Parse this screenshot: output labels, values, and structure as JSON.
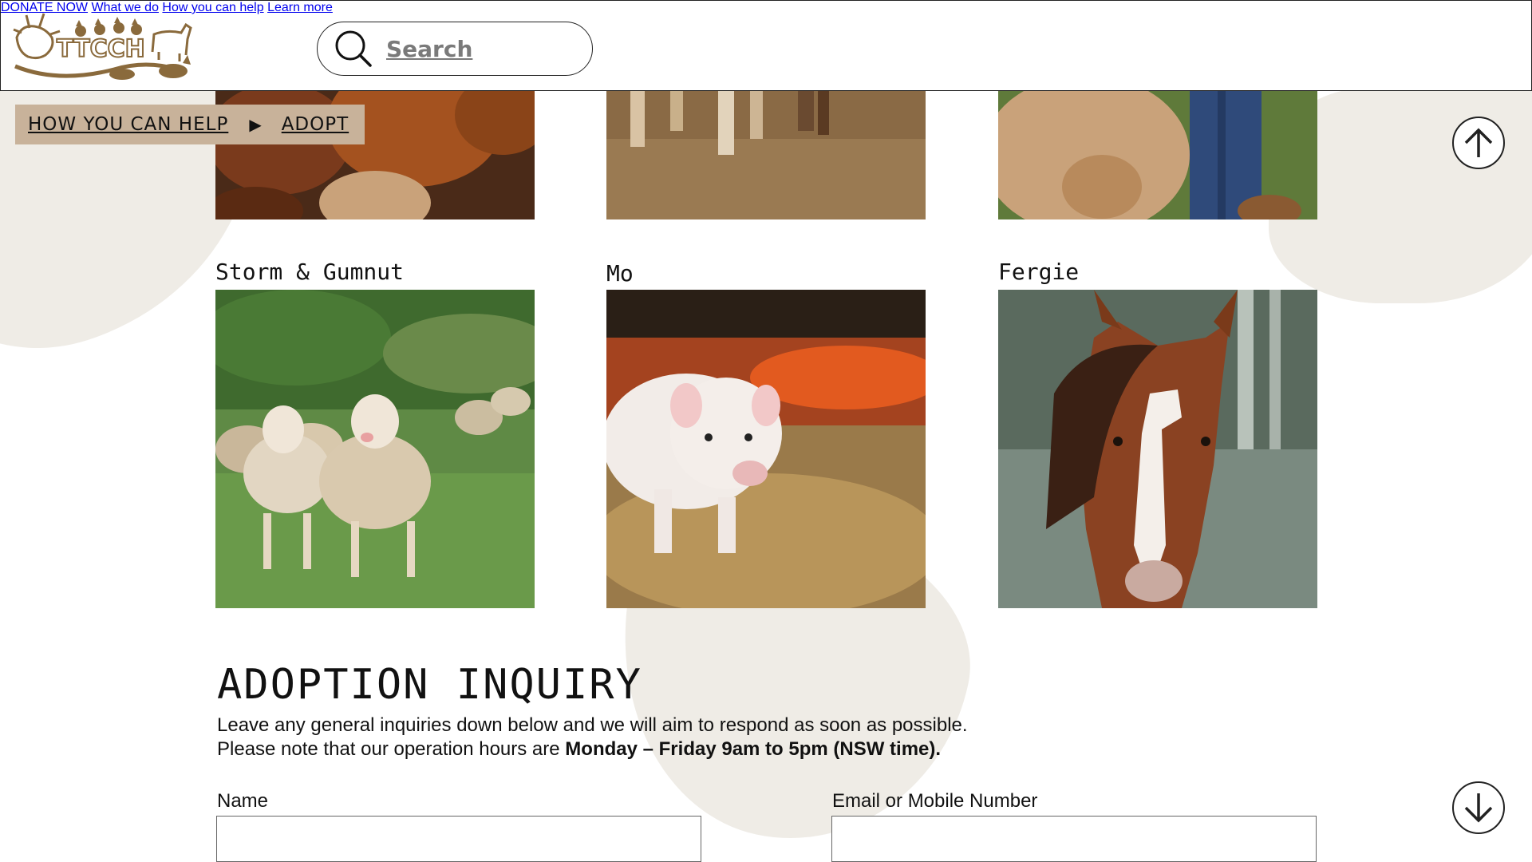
{
  "header": {
    "logo_text": "TTCCH",
    "search": {
      "placeholder": "Search"
    },
    "nav": [
      "DONATE NOW",
      "What we do",
      "How you can help",
      "Learn more"
    ]
  },
  "breadcrumb": {
    "items": [
      "HOW YOU CAN HELP",
      "ADOPT"
    ],
    "separator": "▶"
  },
  "animals": {
    "top_row": [
      {
        "name": "",
        "photo": "chickens-photo"
      },
      {
        "name": "",
        "photo": "goat-legs-photo"
      },
      {
        "name": "",
        "photo": "calf-photo"
      }
    ],
    "cards": [
      {
        "name": "Storm & Gumnut",
        "photo": "sheep-photo"
      },
      {
        "name": "Mo",
        "photo": "piglet-photo"
      },
      {
        "name": "Fergie",
        "photo": "horse-photo"
      }
    ]
  },
  "inquiry": {
    "title": "ADOPTION INQUIRY",
    "line1": "Leave any general inquiries down below and we will aim to respond as soon as possible.",
    "line2_prefix": "Please note that our operation hours are ",
    "line2_bold": "Monday – Friday 9am to 5pm (NSW time).",
    "fields": [
      {
        "label": "Name",
        "value": ""
      },
      {
        "label": "Email or Mobile Number",
        "value": ""
      }
    ]
  },
  "colors": {
    "brand_brown": "#8a6a3c",
    "breadcrumb_bg": "#c8b29a",
    "blob": "#efece6"
  },
  "icons": {
    "scroll_up": "arrow-up-icon",
    "scroll_down": "arrow-down-icon",
    "search": "search-icon"
  }
}
